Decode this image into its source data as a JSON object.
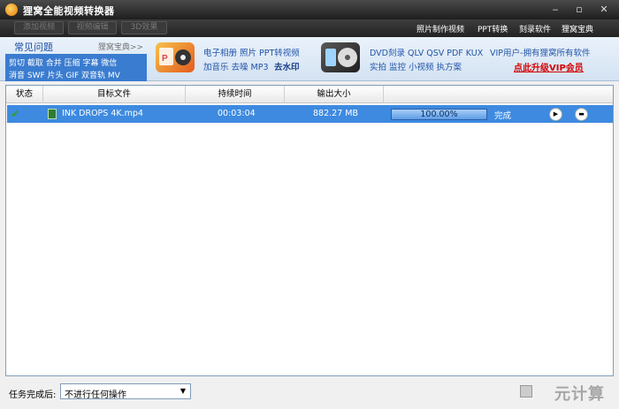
{
  "window": {
    "title": "狸窝全能视频转换器",
    "controls": [
      "‒",
      "▫",
      "✕"
    ]
  },
  "toolbar": {
    "buttons": [
      "添加视频",
      "视频编辑",
      "3D效果"
    ],
    "links": [
      "照片制作视频",
      "PPT转换",
      "刻录软件",
      "狸窝宝典"
    ]
  },
  "banner": {
    "faq_title": "常见问题",
    "faq_more": "狸窝宝典>>",
    "faq_lines": [
      "剪切 截取 合并 压缩 字幕 微信",
      "消音 SWF 片头 GIF 双音轨 MV"
    ],
    "promo1_lines": [
      "电子相册 照片 PPT转视频",
      "加音乐 去噪 MP3"
    ],
    "promo1_strong": "去水印",
    "promo2_lines": [
      "DVD刻录 QLV QSV PDF KUX",
      "实拍 监控 小视频 执方案"
    ],
    "vip_line": "VIP用户-拥有狸窝所有软件",
    "vip_link": "点此升级VIP会员"
  },
  "list": {
    "columns": [
      "状态",
      "目标文件",
      "持续时间",
      "输出大小"
    ],
    "rows": [
      {
        "file": "INK DROPS 4K.mp4",
        "duration": "00:03:04",
        "size": "882.27 MB",
        "progress_text": "100.00%",
        "progress": 1.0,
        "status": "完成"
      }
    ]
  },
  "footer": {
    "after_label": "任务完成后:",
    "after_value": "不进行任何操作",
    "watermark": "元计算"
  },
  "colors": {
    "titlebar": "#2a2a2a",
    "selected_row": "#3d8ae0",
    "vip_link": "#d40000",
    "faq_box": "#3a7cd0"
  }
}
